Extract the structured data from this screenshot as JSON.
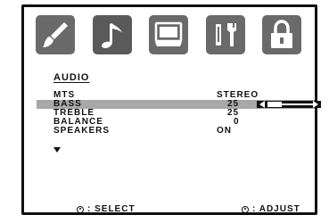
{
  "tabs": [
    {
      "id": "picture",
      "icon": "brush-icon",
      "active": false
    },
    {
      "id": "audio",
      "icon": "music-note-icon",
      "active": true
    },
    {
      "id": "timer",
      "icon": "tv-screen-icon",
      "active": false
    },
    {
      "id": "setup",
      "icon": "tools-icon",
      "active": false
    },
    {
      "id": "lock",
      "icon": "padlock-icon",
      "active": false
    }
  ],
  "section": {
    "title": "AUDIO"
  },
  "menu": {
    "items": [
      {
        "label": "MTS",
        "value": "STEREO"
      },
      {
        "label": "BASS",
        "value": "25",
        "selected": true,
        "slider_percent": 25
      },
      {
        "label": "TREBLE",
        "value": "25"
      },
      {
        "label": "BALANCE",
        "value": "0"
      },
      {
        "label": "SPEAKERS",
        "value": "ON"
      }
    ]
  },
  "footer": {
    "select_label": ": SELECT",
    "adjust_label": ": ADJUST"
  },
  "colors": {
    "tab_active": "#5a5a5a",
    "tab_default": "#6a6a6a",
    "tab_inactive": "#bcbcbc",
    "selected_row": "#a8a8a8",
    "text": "#111111"
  }
}
